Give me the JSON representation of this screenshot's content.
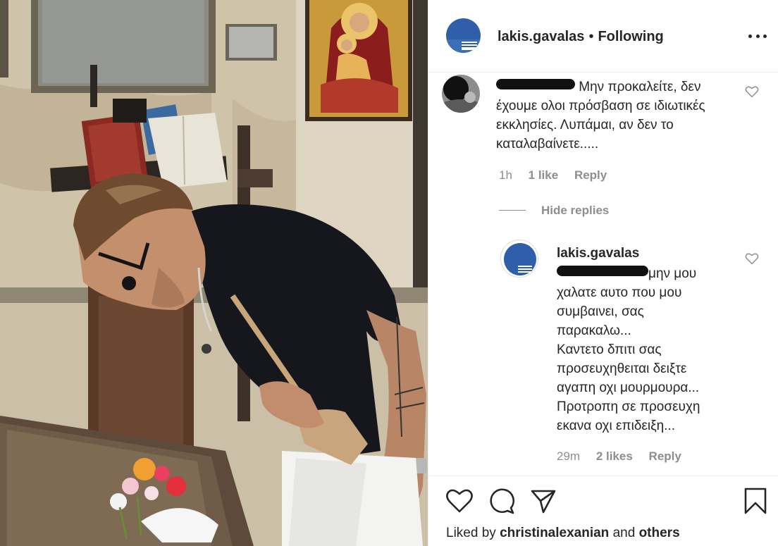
{
  "header": {
    "username": "lakis.gavalas",
    "separator": "•",
    "follow_status": "Following",
    "more_icon": "more-dots-icon"
  },
  "comments": [
    {
      "username_redacted": true,
      "text": "Μην προκαλείτε, δεν έχουμε ολοι πρόσβαση σε ιδιωτικές εκκλησίες. Λυπάμαι, αν δεν το καταλαβαίνετε.....",
      "time": "1h",
      "likes": "1 like",
      "reply_label": "Reply"
    }
  ],
  "hide_replies_label": "Hide replies",
  "reply": {
    "username": "lakis.gavalas",
    "lines": [
      "μην μου",
      "χαλατε αυτο που μου",
      "συμβαινει, σας",
      "παρακαλω...",
      "Καντετο δπιτι σας",
      "προσευχηθειται δειξτε",
      "αγαπη οχι μουρμουρα...",
      "Προτροπη σε προσευχη",
      "εκανα οχι επιδειξη..."
    ],
    "time": "29m",
    "likes": "2 likes",
    "reply_label": "Reply"
  },
  "actions": {
    "like_icon": "heart-icon",
    "comment_icon": "comment-icon",
    "share_icon": "share-icon",
    "save_icon": "bookmark-icon"
  },
  "liked_by": {
    "prefix": "Liked by",
    "user": "christinalexanian",
    "conj": "and",
    "others": "others"
  },
  "colors": {
    "text": "#262626",
    "secondary": "#8e8e8e",
    "divider": "#efefef",
    "avatar_blue": "#2f5fa8"
  }
}
